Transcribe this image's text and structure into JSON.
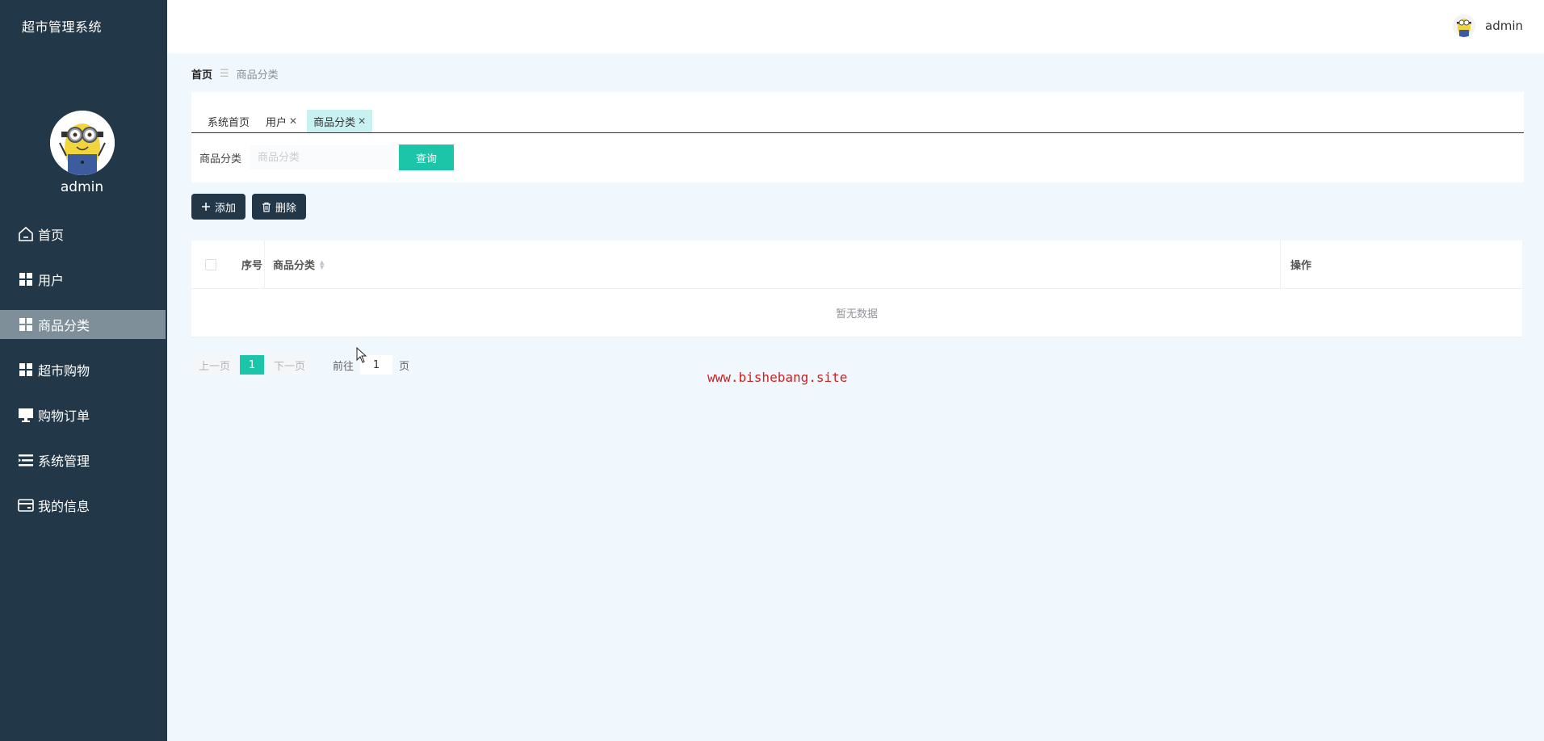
{
  "app": {
    "title": "超市管理系统"
  },
  "sidebar": {
    "username": "admin",
    "items": [
      {
        "label": "首页",
        "icon": "home-icon"
      },
      {
        "label": "用户",
        "icon": "grid-icon"
      },
      {
        "label": "商品分类",
        "icon": "grid-icon",
        "active": true
      },
      {
        "label": "超市购物",
        "icon": "grid-icon"
      },
      {
        "label": "购物订单",
        "icon": "monitor-icon"
      },
      {
        "label": "系统管理",
        "icon": "list-icon"
      },
      {
        "label": "我的信息",
        "icon": "card-icon"
      }
    ]
  },
  "header": {
    "username": "admin"
  },
  "breadcrumb": {
    "home": "首页",
    "separator": "☰",
    "current": "商品分类"
  },
  "tabs": [
    {
      "label": "系统首页",
      "closable": false
    },
    {
      "label": "用户",
      "closable": true
    },
    {
      "label": "商品分类",
      "closable": true,
      "active": true
    }
  ],
  "search": {
    "label": "商品分类",
    "placeholder": "商品分类",
    "value": "",
    "button": "查询"
  },
  "actions": {
    "add": "添加",
    "delete": "删除"
  },
  "table": {
    "headers": {
      "index": "序号",
      "category": "商品分类",
      "ops": "操作"
    },
    "empty_text": "暂无数据",
    "rows": []
  },
  "pagination": {
    "prev": "上一页",
    "next": "下一页",
    "current_page": "1",
    "goto_label": "前往",
    "goto_value": "1",
    "goto_unit": "页"
  },
  "watermark": "www.bishebang.site",
  "colors": {
    "sidebar_bg": "#223848",
    "accent": "#1cc5a8",
    "active_tab": "#c8f1f1",
    "page_bg": "#f0f7fd"
  }
}
